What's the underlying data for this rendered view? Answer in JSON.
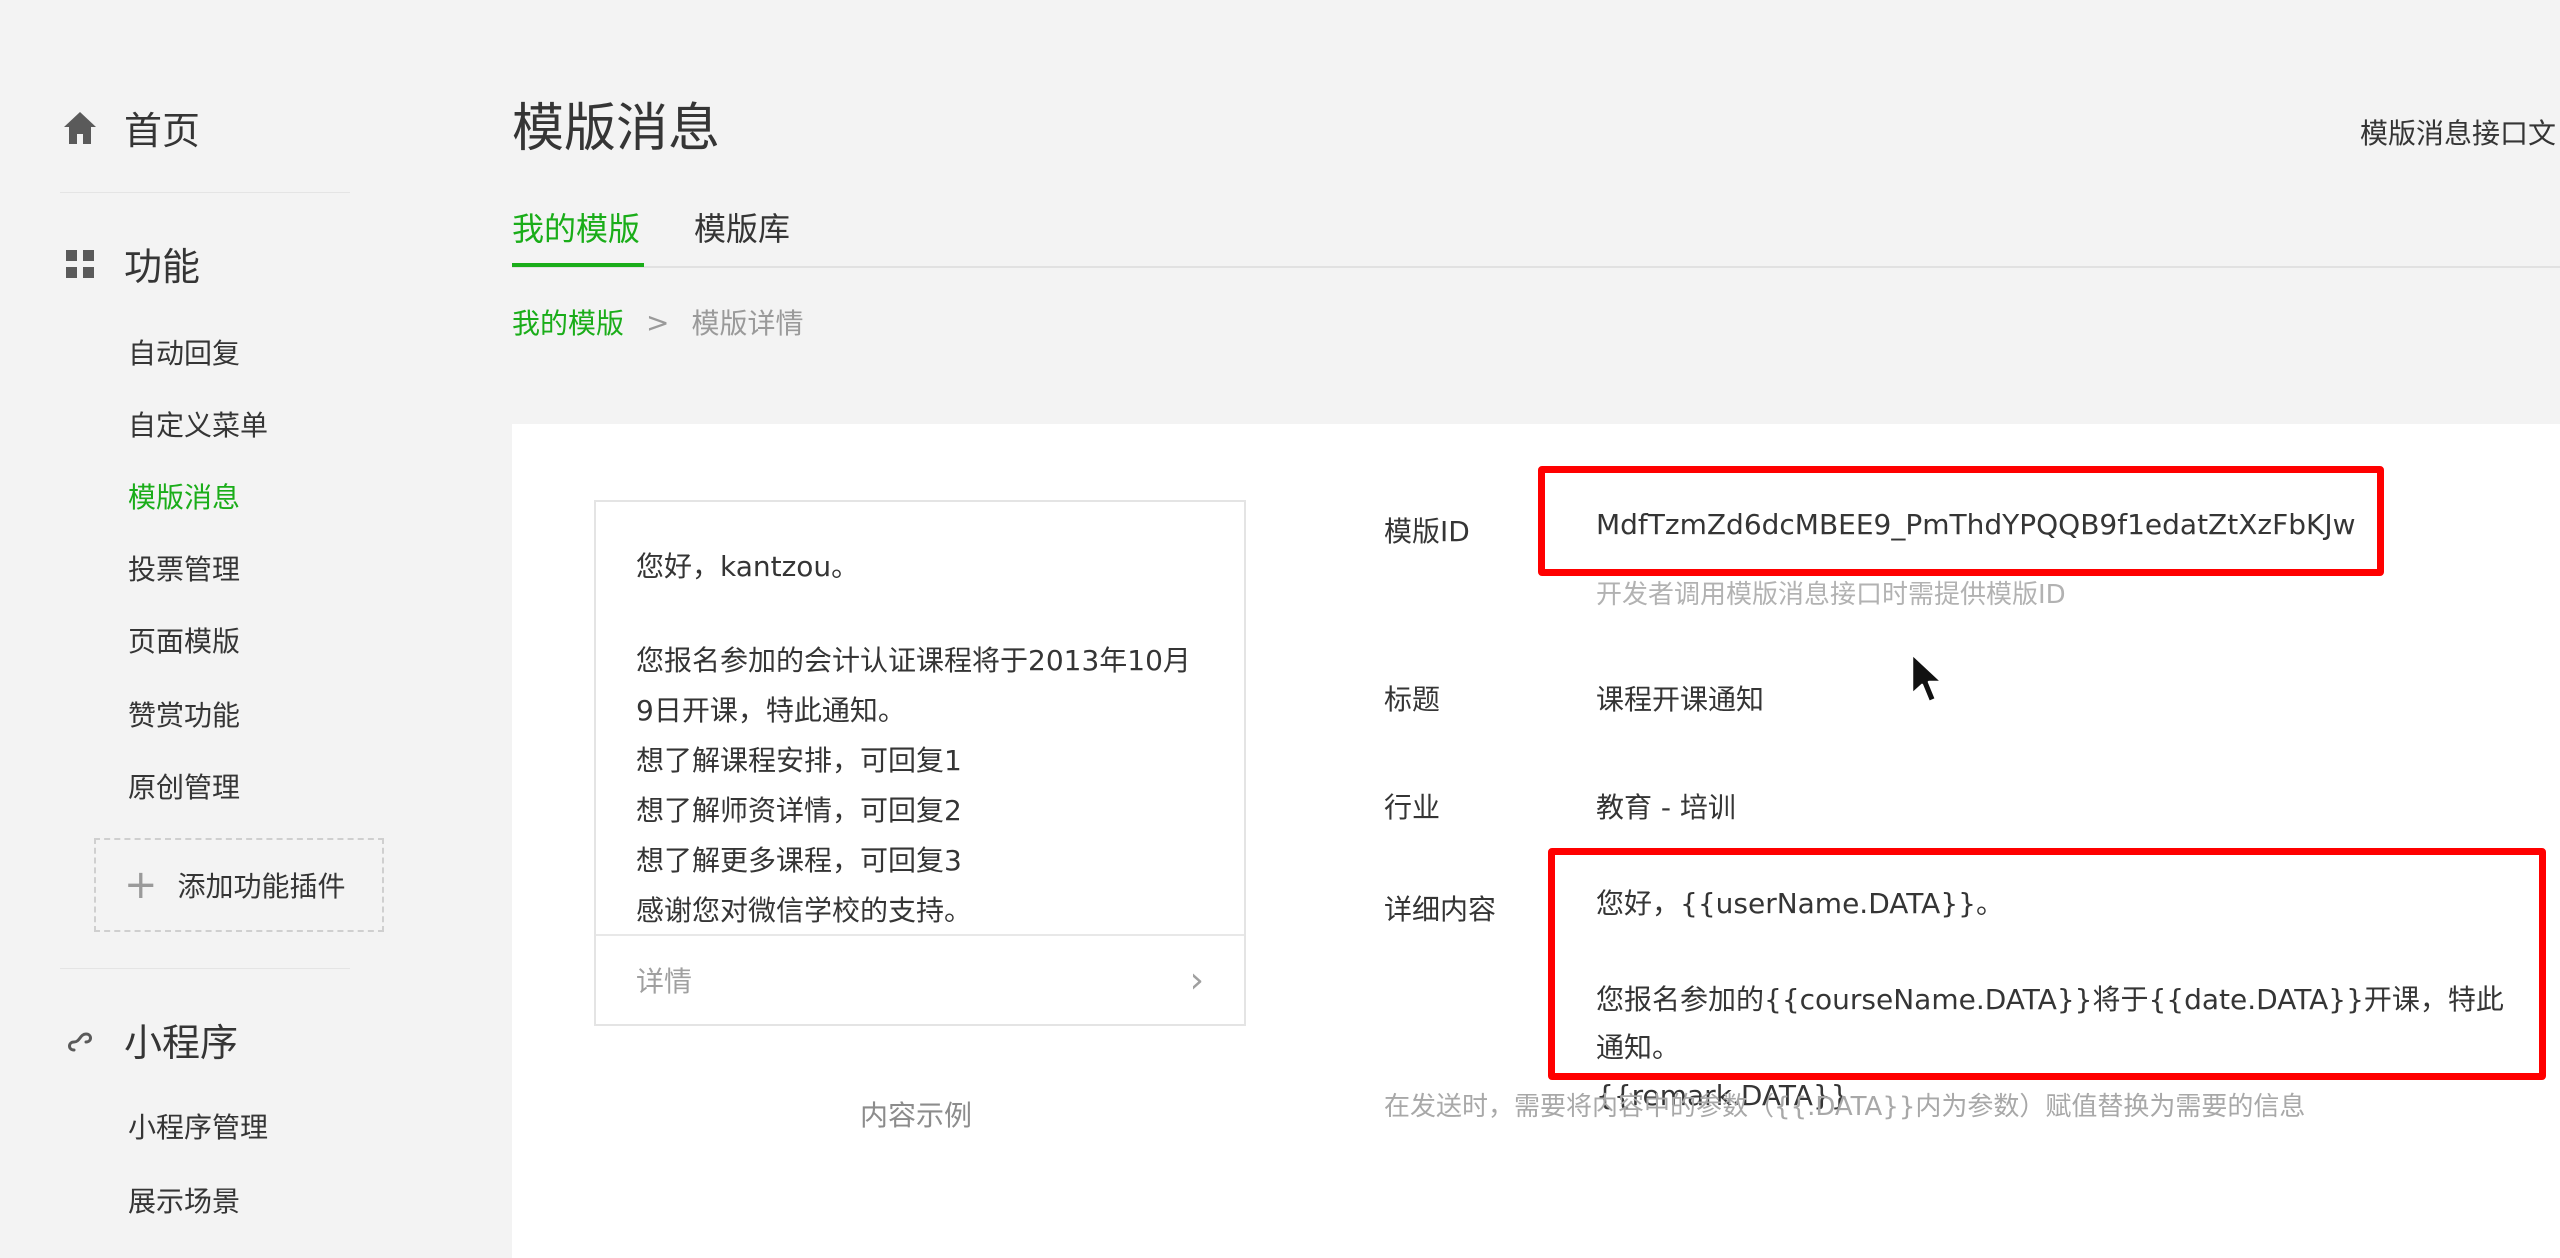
{
  "sidebar": {
    "home": {
      "label": "首页",
      "icon": "home-icon"
    },
    "features": {
      "label": "功能",
      "icon": "grid-icon",
      "items": [
        {
          "label": "自动回复",
          "active": false
        },
        {
          "label": "自定义菜单",
          "active": false
        },
        {
          "label": "模版消息",
          "active": true
        },
        {
          "label": "投票管理",
          "active": false
        },
        {
          "label": "页面模版",
          "active": false
        },
        {
          "label": "赞赏功能",
          "active": false
        },
        {
          "label": "原创管理",
          "active": false
        }
      ],
      "add_plugin": "添加功能插件"
    },
    "miniprogram": {
      "label": "小程序",
      "icon": "link-icon",
      "items": [
        {
          "label": "小程序管理"
        },
        {
          "label": "展示场景"
        }
      ]
    }
  },
  "header": {
    "title": "模版消息",
    "doc_link": "模版消息接口文"
  },
  "tabs": [
    {
      "label": "我的模版",
      "active": true
    },
    {
      "label": "模版库",
      "active": false
    }
  ],
  "breadcrumb": {
    "current": "我的模版",
    "separator": ">",
    "page": "模版详情"
  },
  "preview": {
    "greeting": "您好，kantzou。",
    "lines": [
      "您报名参加的会计认证课程将于2013年10月",
      "9日开课，特此通知。",
      "想了解课程安排，可回复1",
      "想了解师资详情，可回复2",
      "想了解更多课程，可回复3",
      "感谢您对微信学校的支持。"
    ],
    "footer_label": "详情",
    "footer_arrow": "›",
    "caption": "内容示例"
  },
  "details": {
    "template_id_label": "模版ID",
    "template_id": "MdfTzmZd6dcMBEE9_PmThdYPQQB9f1edatZtXzFbKJw",
    "template_id_hint": "开发者调用模版消息接口时需提供模版ID",
    "title_label": "标题",
    "title_value": "课程开课通知",
    "industry_label": "行业",
    "industry_value": "教育 - 培训",
    "content_label": "详细内容",
    "content_lines": [
      "您好，{{userName.DATA}}。",
      "",
      "您报名参加的{{courseName.DATA}}将于{{date.DATA}}开课，特此通知。",
      "{{remark.DATA}}"
    ],
    "content_hint": "在发送时，需要将内容中的参数（{{.DATA}}内为参数）赋值替换为需要的信息"
  },
  "colors": {
    "accent": "#1aad19",
    "highlight_box": "#ff0000",
    "background": "#f3f3f3"
  }
}
